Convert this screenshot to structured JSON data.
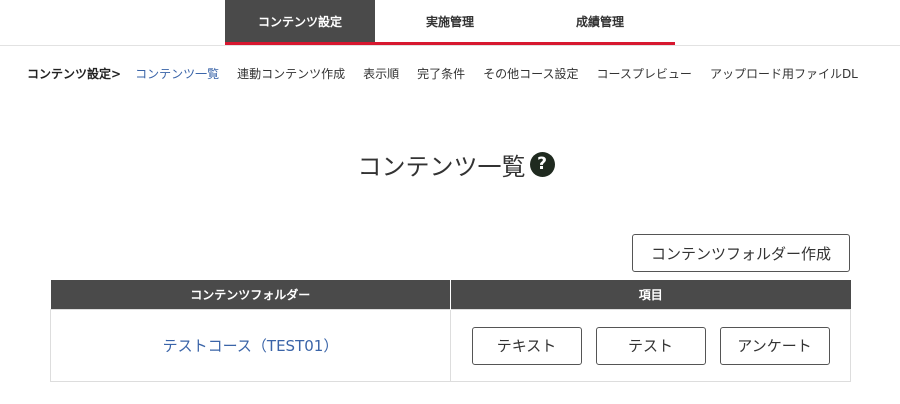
{
  "top_tabs": [
    {
      "label": "コンテンツ設定",
      "active": true
    },
    {
      "label": "実施管理",
      "active": false
    },
    {
      "label": "成績管理",
      "active": false
    }
  ],
  "subnav": {
    "current_section": "コンテンツ設定>",
    "links": [
      {
        "label": "コンテンツ一覧",
        "active": true
      },
      {
        "label": "連動コンテンツ作成",
        "active": false
      },
      {
        "label": "表示順",
        "active": false
      },
      {
        "label": "完了条件",
        "active": false
      },
      {
        "label": "その他コース設定",
        "active": false
      },
      {
        "label": "コースプレビュー",
        "active": false
      },
      {
        "label": "アップロード用ファイルDL",
        "active": false
      }
    ]
  },
  "page": {
    "title": "コンテンツ一覧",
    "help_icon_glyph": "?",
    "create_folder_button": "コンテンツフォルダー作成"
  },
  "table": {
    "headers": [
      "コンテンツフォルダー",
      "項目"
    ],
    "rows": [
      {
        "folder": "テストコース（TEST01）",
        "items": [
          "テキスト",
          "テスト",
          "アンケート"
        ]
      }
    ]
  },
  "colors": {
    "accent_red": "#d7172f",
    "tab_active_bg": "#4a4a4a",
    "link_blue": "#3a64a8",
    "help_icon_bg": "#1f2a1f"
  },
  "icons": {
    "help": "question-circle-icon"
  }
}
